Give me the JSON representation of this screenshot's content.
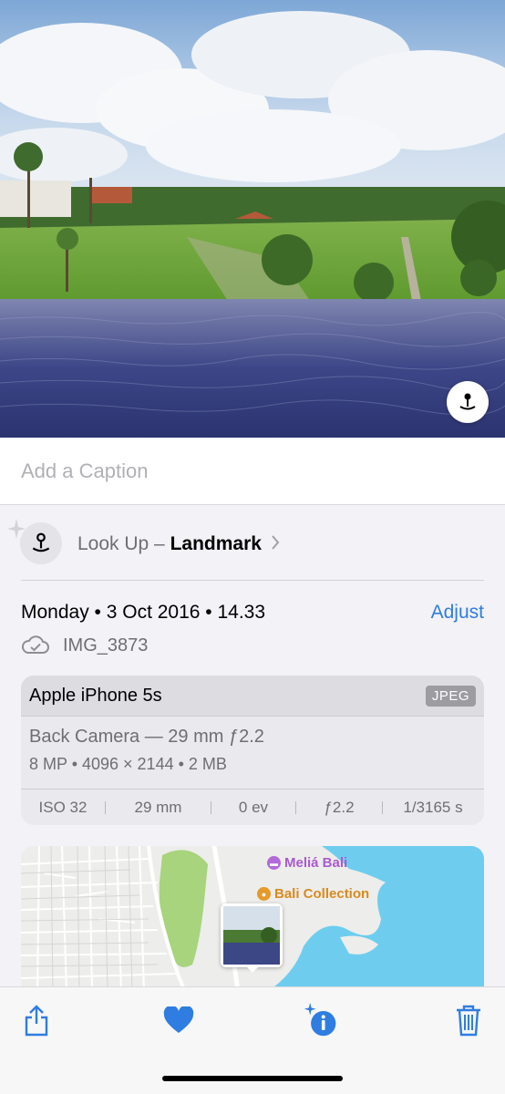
{
  "caption": {
    "placeholder": "Add a Caption"
  },
  "lookup": {
    "prefix": "Look Up – ",
    "bold": "Landmark"
  },
  "info": {
    "date": "Monday • 3 Oct 2016 • 14.33",
    "adjust_label": "Adjust",
    "filename": "IMG_3873"
  },
  "meta": {
    "device": "Apple iPhone 5s",
    "format": "JPEG",
    "lens": "Back Camera — 29 mm ƒ2.2",
    "specs": "8 MP  •  4096 × 2144  •  2 MB",
    "exif": [
      "ISO 32",
      "29 mm",
      "0 ev",
      "ƒ2.2",
      "1/3165 s"
    ]
  },
  "map": {
    "poi1": "Meliá Bali",
    "poi2": "Bali Collection"
  },
  "colors": {
    "accent": "#2f7de1",
    "background": "#f2f2f7"
  },
  "icons": [
    "visual-lookup-icon",
    "sparkle-icon",
    "chevron-right-icon",
    "icloud-check-icon",
    "share-icon",
    "heart-icon",
    "info-sparkle-icon",
    "trash-icon"
  ]
}
